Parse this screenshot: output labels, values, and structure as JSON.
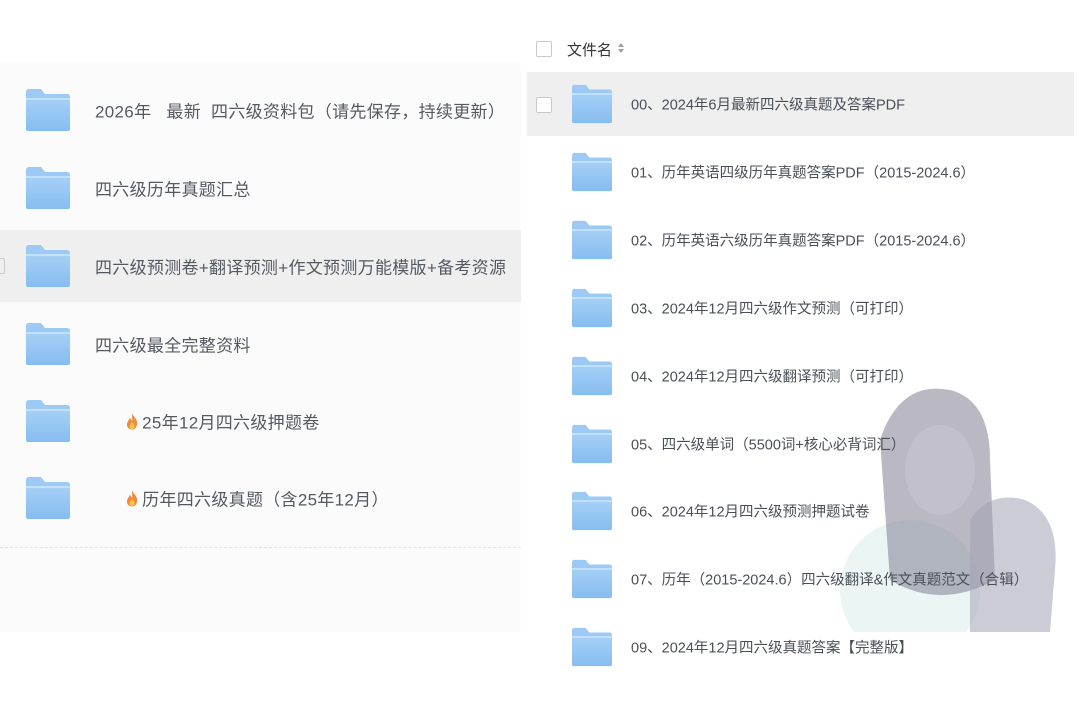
{
  "left_list": {
    "items": [
      {
        "label": "2026年   最新  四六级资料包（请先保存，持续更新）",
        "fire": false
      },
      {
        "label": "四六级历年真题汇总",
        "fire": false
      },
      {
        "label": "四六级预测卷+翻译预测+作文预测万能模版+备考资源",
        "fire": false
      },
      {
        "label": "四六级最全完整资料",
        "fire": false
      },
      {
        "label": "25年12月四六级押题卷",
        "fire": true
      },
      {
        "label": "历年四六级真题（含25年12月）",
        "fire": true
      }
    ]
  },
  "right_list": {
    "header": {
      "title": "文件名"
    },
    "items": [
      {
        "label": "00、2024年6月最新四六级真题及答案PDF"
      },
      {
        "label": "01、历年英语四级历年真题答案PDF（2015-2024.6）"
      },
      {
        "label": "02、历年英语六级历年真题答案PDF（2015-2024.6）"
      },
      {
        "label": "03、2024年12月四六级作文预测（可打印）"
      },
      {
        "label": "04、2024年12月四六级翻译预测（可打印）"
      },
      {
        "label": "05、四六级单词（5500词+核心必背词汇）"
      },
      {
        "label": "06、2024年12月四六级预测押题试卷"
      },
      {
        "label": "07、历年（2015-2024.6）四六级翻译&作文真题范文（合辑）"
      },
      {
        "label": "09、2024年12月四六级真题答案【完整版】"
      }
    ]
  },
  "colors": {
    "folder_front": "#8fc3f3",
    "folder_back": "#b7dafa",
    "row_hover": "#efeff0"
  }
}
